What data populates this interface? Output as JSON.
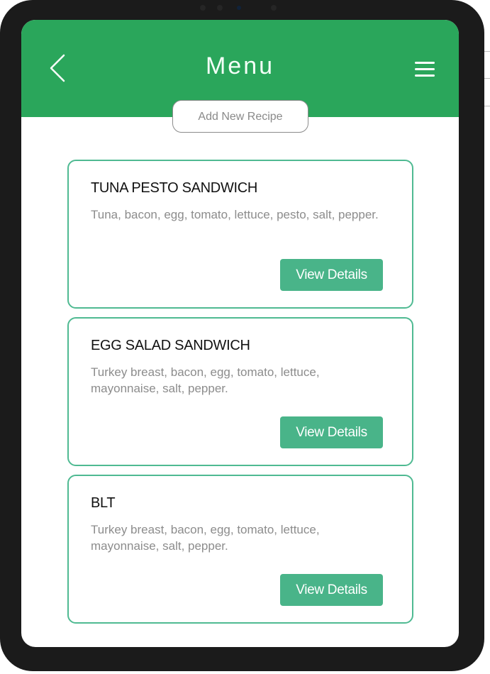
{
  "header": {
    "title": "Menu",
    "back_icon": "chevron-left-icon",
    "menu_icon": "hamburger-menu-icon",
    "color": "#2aa65b"
  },
  "add_recipe_label": "Add New Recipe",
  "recipes": [
    {
      "title": "TUNA PESTO SANDWICH",
      "ingredients": "Tuna, bacon, egg, tomato, lettuce, pesto, salt, pepper.",
      "button_label": "View Details"
    },
    {
      "title": "EGG SALAD SANDWICH",
      "ingredients": "Turkey breast, bacon, egg, tomato, lettuce, mayonnaise, salt,  pepper.",
      "button_label": "View Details"
    },
    {
      "title": "BLT",
      "ingredients": "Turkey breast, bacon, egg, tomato, lettuce, mayonnaise, salt,  pepper.",
      "button_label": "View Details"
    }
  ],
  "colors": {
    "accent": "#49b489",
    "card_border": "#4fba92",
    "device_frame": "#1b1b1b"
  }
}
